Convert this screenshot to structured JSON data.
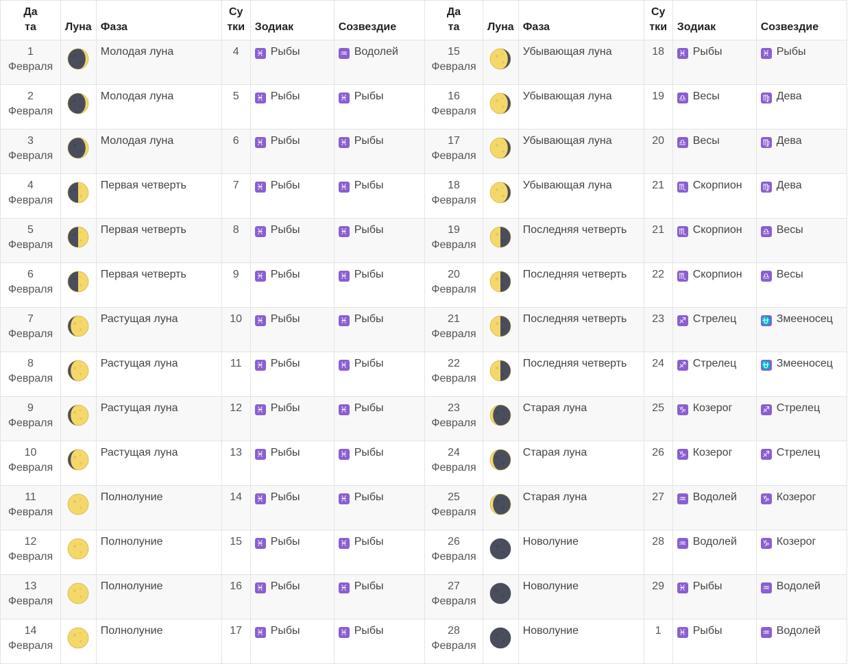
{
  "headers": {
    "date_line1": "Да",
    "date_line2": "та",
    "moon": "Луна",
    "phase": "Фаза",
    "day_line1": "Су",
    "day_line2": "тки",
    "zodiac": "Зодиак",
    "constellation": "Созвездие"
  },
  "colors": {
    "badge": "#8a5fd1",
    "stripe": "#f8f8f8",
    "border": "#e4e4e4"
  },
  "signs": {
    "Рыбы": "♓",
    "Водолей": "♒",
    "Весы": "♎",
    "Дева": "♍",
    "Скорпион": "♏",
    "Стрелец": "♐",
    "Змееносец": "⛎",
    "Козерог": "♑"
  },
  "rows": [
    {
      "day": "1",
      "month": "Февраля",
      "moon": "waxing-crescent",
      "phase": "Молодая луна",
      "lunar_day": "4",
      "zodiac": "Рыбы",
      "constellation": "Водолей"
    },
    {
      "day": "2",
      "month": "Февраля",
      "moon": "waxing-crescent",
      "phase": "Молодая луна",
      "lunar_day": "5",
      "zodiac": "Рыбы",
      "constellation": "Рыбы"
    },
    {
      "day": "3",
      "month": "Февраля",
      "moon": "waxing-crescent",
      "phase": "Молодая луна",
      "lunar_day": "6",
      "zodiac": "Рыбы",
      "constellation": "Рыбы"
    },
    {
      "day": "4",
      "month": "Февраля",
      "moon": "first-quarter",
      "phase": "Первая четверть",
      "lunar_day": "7",
      "zodiac": "Рыбы",
      "constellation": "Рыбы"
    },
    {
      "day": "5",
      "month": "Февраля",
      "moon": "first-quarter",
      "phase": "Первая четверть",
      "lunar_day": "8",
      "zodiac": "Рыбы",
      "constellation": "Рыбы"
    },
    {
      "day": "6",
      "month": "Февраля",
      "moon": "first-quarter",
      "phase": "Первая четверть",
      "lunar_day": "9",
      "zodiac": "Рыбы",
      "constellation": "Рыбы"
    },
    {
      "day": "7",
      "month": "Февраля",
      "moon": "waxing-gibbous",
      "phase": "Растущая луна",
      "lunar_day": "10",
      "zodiac": "Рыбы",
      "constellation": "Рыбы"
    },
    {
      "day": "8",
      "month": "Февраля",
      "moon": "waxing-gibbous",
      "phase": "Растущая луна",
      "lunar_day": "11",
      "zodiac": "Рыбы",
      "constellation": "Рыбы"
    },
    {
      "day": "9",
      "month": "Февраля",
      "moon": "waxing-gibbous",
      "phase": "Растущая луна",
      "lunar_day": "12",
      "zodiac": "Рыбы",
      "constellation": "Рыбы"
    },
    {
      "day": "10",
      "month": "Февраля",
      "moon": "waxing-gibbous",
      "phase": "Растущая луна",
      "lunar_day": "13",
      "zodiac": "Рыбы",
      "constellation": "Рыбы"
    },
    {
      "day": "11",
      "month": "Февраля",
      "moon": "full",
      "phase": "Полнолуние",
      "lunar_day": "14",
      "zodiac": "Рыбы",
      "constellation": "Рыбы"
    },
    {
      "day": "12",
      "month": "Февраля",
      "moon": "full",
      "phase": "Полнолуние",
      "lunar_day": "15",
      "zodiac": "Рыбы",
      "constellation": "Рыбы"
    },
    {
      "day": "13",
      "month": "Февраля",
      "moon": "full",
      "phase": "Полнолуние",
      "lunar_day": "16",
      "zodiac": "Рыбы",
      "constellation": "Рыбы"
    },
    {
      "day": "14",
      "month": "Февраля",
      "moon": "full",
      "phase": "Полнолуние",
      "lunar_day": "17",
      "zodiac": "Рыбы",
      "constellation": "Рыбы"
    },
    {
      "day": "15",
      "month": "Февраля",
      "moon": "waning-gibbous",
      "phase": "Убывающая луна",
      "lunar_day": "18",
      "zodiac": "Рыбы",
      "constellation": "Рыбы"
    },
    {
      "day": "16",
      "month": "Февраля",
      "moon": "waning-gibbous",
      "phase": "Убывающая луна",
      "lunar_day": "19",
      "zodiac": "Весы",
      "constellation": "Дева"
    },
    {
      "day": "17",
      "month": "Февраля",
      "moon": "waning-gibbous",
      "phase": "Убывающая луна",
      "lunar_day": "20",
      "zodiac": "Весы",
      "constellation": "Дева"
    },
    {
      "day": "18",
      "month": "Февраля",
      "moon": "waning-gibbous",
      "phase": "Убывающая луна",
      "lunar_day": "21",
      "zodiac": "Скорпион",
      "constellation": "Дева"
    },
    {
      "day": "19",
      "month": "Февраля",
      "moon": "last-quarter",
      "phase": "Последняя четверть",
      "lunar_day": "21",
      "zodiac": "Скорпион",
      "constellation": "Весы"
    },
    {
      "day": "20",
      "month": "Февраля",
      "moon": "last-quarter",
      "phase": "Последняя четверть",
      "lunar_day": "22",
      "zodiac": "Скорпион",
      "constellation": "Весы"
    },
    {
      "day": "21",
      "month": "Февраля",
      "moon": "last-quarter",
      "phase": "Последняя четверть",
      "lunar_day": "23",
      "zodiac": "Стрелец",
      "constellation": "Змееносец"
    },
    {
      "day": "22",
      "month": "Февраля",
      "moon": "last-quarter",
      "phase": "Последняя четверть",
      "lunar_day": "24",
      "zodiac": "Стрелец",
      "constellation": "Змееносец"
    },
    {
      "day": "23",
      "month": "Февраля",
      "moon": "waning-crescent",
      "phase": "Старая луна",
      "lunar_day": "25",
      "zodiac": "Козерог",
      "constellation": "Стрелец"
    },
    {
      "day": "24",
      "month": "Февраля",
      "moon": "waning-crescent",
      "phase": "Старая луна",
      "lunar_day": "26",
      "zodiac": "Козерог",
      "constellation": "Стрелец"
    },
    {
      "day": "25",
      "month": "Февраля",
      "moon": "waning-crescent",
      "phase": "Старая луна",
      "lunar_day": "27",
      "zodiac": "Водолей",
      "constellation": "Козерог"
    },
    {
      "day": "26",
      "month": "Февраля",
      "moon": "new",
      "phase": "Новолуние",
      "lunar_day": "28",
      "zodiac": "Водолей",
      "constellation": "Козерог"
    },
    {
      "day": "27",
      "month": "Февраля",
      "moon": "new",
      "phase": "Новолуние",
      "lunar_day": "29",
      "zodiac": "Рыбы",
      "constellation": "Водолей"
    },
    {
      "day": "28",
      "month": "Февраля",
      "moon": "new",
      "phase": "Новолуние",
      "lunar_day": "1",
      "zodiac": "Рыбы",
      "constellation": "Водолей"
    }
  ]
}
